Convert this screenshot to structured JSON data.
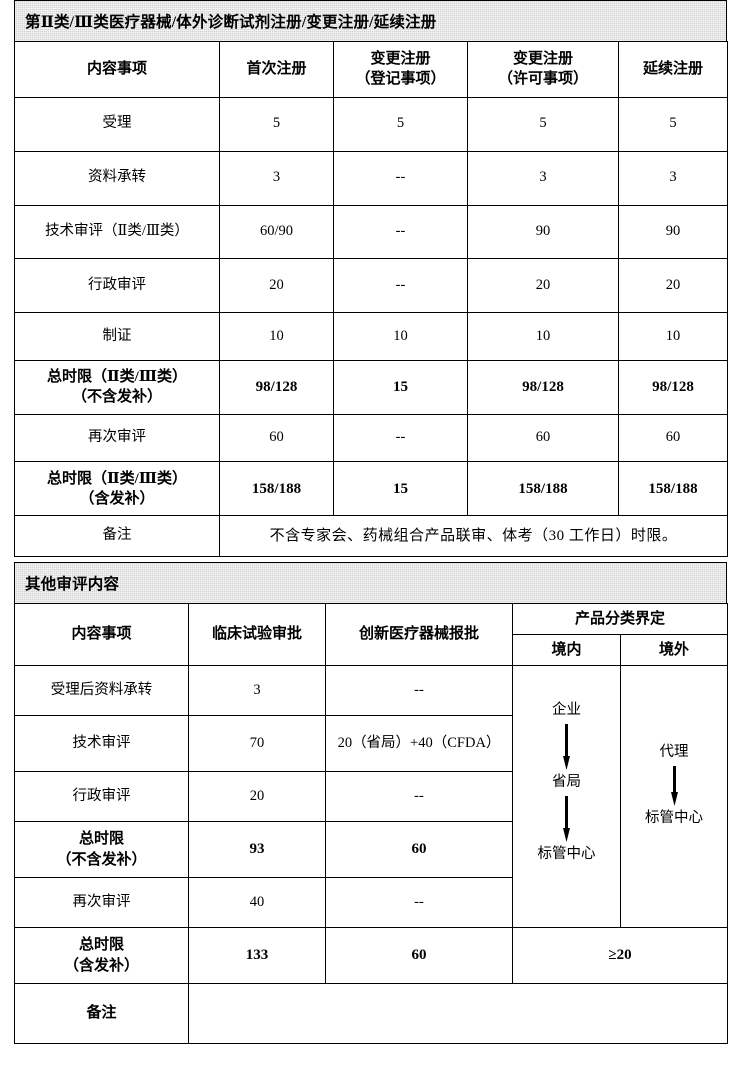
{
  "doc": {
    "section1_title": "第Ⅱ类/Ⅲ类医疗器械/体外诊断试剂注册/变更注册/延续注册",
    "section2_title": "其他审评内容"
  },
  "table1": {
    "headers": [
      "内容事项",
      "首次注册",
      "变更注册\n（登记事项）",
      "变更注册\n（许可事项）",
      "延续注册"
    ],
    "header_cells": [
      {
        "line1": "内容事项",
        "line2": ""
      },
      {
        "line1": "首次注册",
        "line2": ""
      },
      {
        "line1": "变更注册",
        "line2": "（登记事项）"
      },
      {
        "line1": "变更注册",
        "line2": "（许可事项）"
      },
      {
        "line1": "延续注册",
        "line2": ""
      }
    ],
    "rows": [
      {
        "label_line1": "受理",
        "label_line2": "",
        "bold": false,
        "values": [
          "5",
          "5",
          "5",
          "5"
        ]
      },
      {
        "label_line1": "资料承转",
        "label_line2": "",
        "bold": false,
        "values": [
          "3",
          "--",
          "3",
          "3"
        ]
      },
      {
        "label_line1": "技术审评（Ⅱ类/Ⅲ类）",
        "label_line2": "",
        "bold": false,
        "values": [
          "60/90",
          "--",
          "90",
          "90"
        ]
      },
      {
        "label_line1": "行政审评",
        "label_line2": "",
        "bold": false,
        "values": [
          "20",
          "--",
          "20",
          "20"
        ]
      },
      {
        "label_line1": "制证",
        "label_line2": "",
        "bold": false,
        "values": [
          "10",
          "10",
          "10",
          "10"
        ]
      },
      {
        "label_line1": "总时限（Ⅱ类/Ⅲ类）",
        "label_line2": "（不含发补）",
        "bold": true,
        "values": [
          "98/128",
          "15",
          "98/128",
          "98/128"
        ]
      },
      {
        "label_line1": "再次审评",
        "label_line2": "",
        "bold": false,
        "values": [
          "60",
          "--",
          "60",
          "60"
        ]
      },
      {
        "label_line1": "总时限（Ⅱ类/Ⅲ类）",
        "label_line2": "（含发补）",
        "bold": true,
        "values": [
          "158/188",
          "15",
          "158/188",
          "158/188"
        ]
      }
    ],
    "note": {
      "label": "备注",
      "text": "不含专家会、药械组合产品联审、体考（30 工作日）时限。"
    }
  },
  "table2": {
    "headers": {
      "col1": "内容事项",
      "col2": "临床试验审批",
      "col3": "创新医疗器械报批",
      "group": "产品分类界定",
      "sub1": "境内",
      "sub2": "境外"
    },
    "rows": [
      {
        "label_line1": "受理后资料承转",
        "label_line2": "",
        "bold": false,
        "c2": "3",
        "c3": "--"
      },
      {
        "label_line1": "技术审评",
        "label_line2": "",
        "bold": false,
        "c2": "70",
        "c3": "20（省局）+40（CFDA）"
      },
      {
        "label_line1": "行政审评",
        "label_line2": "",
        "bold": false,
        "c2": "20",
        "c3": "--"
      },
      {
        "label_line1": "总时限",
        "label_line2": "（不含发补）",
        "bold": true,
        "c2": "93",
        "c3": "60"
      },
      {
        "label_line1": "再次审评",
        "label_line2": "",
        "bold": false,
        "c2": "40",
        "c3": "--"
      }
    ],
    "total_row": {
      "label_line1": "总时限",
      "label_line2": "（含发补）",
      "c2": "133",
      "c3": "60",
      "classification": "≥20"
    },
    "note_row": {
      "label": "备注",
      "value": ""
    },
    "flow_domestic": {
      "nodes": [
        "企业",
        "省局",
        "标管中心"
      ]
    },
    "flow_foreign": {
      "nodes": [
        "代理",
        "标管中心"
      ]
    }
  },
  "colors": {
    "banner_bg": "#d4d4d4",
    "border": "#000000",
    "text": "#000000"
  }
}
